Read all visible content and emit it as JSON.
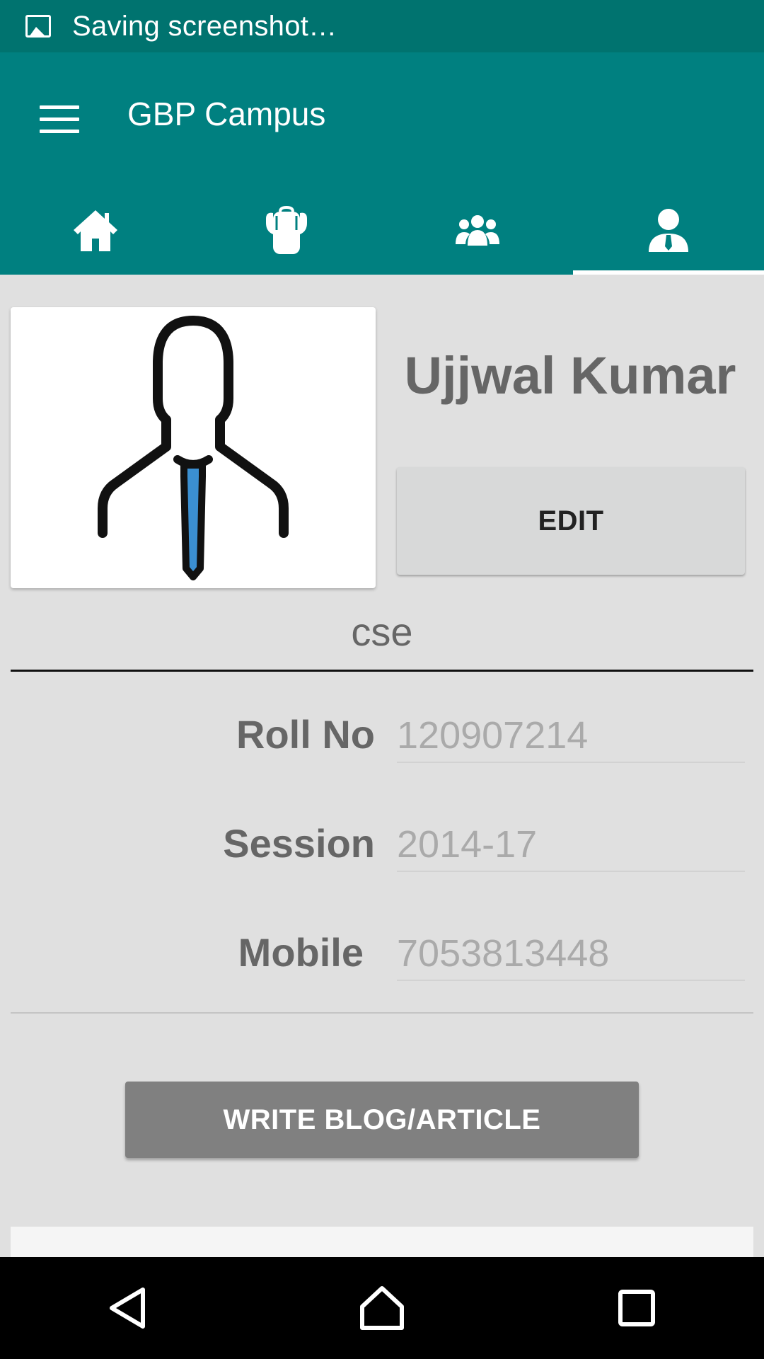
{
  "status_bar": {
    "text": "Saving screenshot…",
    "icon": "image-icon"
  },
  "app_bar": {
    "title": "GBP Campus",
    "menu_icon": "hamburger-menu-icon"
  },
  "tabs": [
    {
      "name": "home",
      "icon": "home-icon",
      "active": false
    },
    {
      "name": "backpack",
      "icon": "backpack-icon",
      "active": false
    },
    {
      "name": "community",
      "icon": "group-icon",
      "active": false
    },
    {
      "name": "profile",
      "icon": "user-tie-icon",
      "active": true
    }
  ],
  "profile": {
    "name": "Ujjwal Kumar",
    "edit_label": "EDIT",
    "department": "cse",
    "fields": [
      {
        "label": "Roll No",
        "value": "120907214"
      },
      {
        "label": "Session",
        "value": "2014-17"
      },
      {
        "label": "Mobile",
        "value": "7053813448"
      }
    ],
    "write_blog_label": "WRITE BLOG/ARTICLE"
  },
  "colors": {
    "primary": "#008080",
    "status_bar": "#00736f",
    "background": "#e0e0e0",
    "tie_blue": "#3b8fd1"
  }
}
